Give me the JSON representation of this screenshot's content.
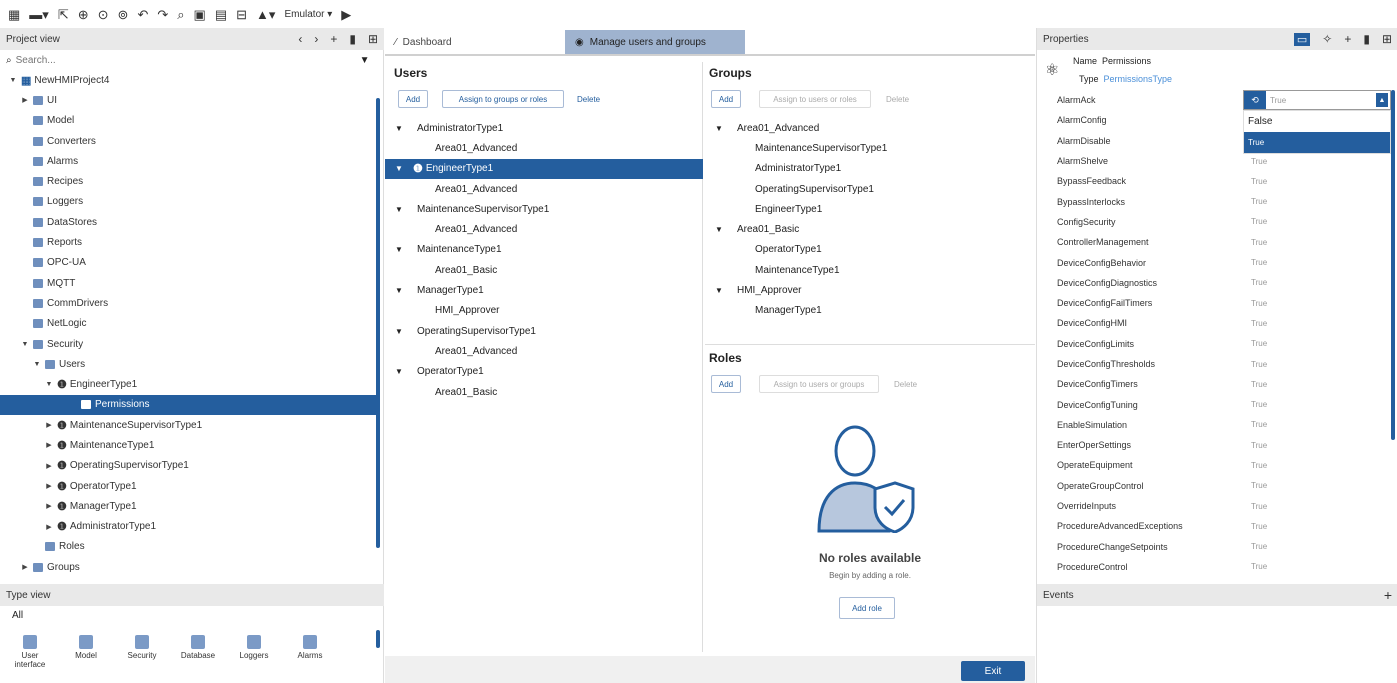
{
  "toolbar": {
    "grid": "▦",
    "save": "▬▾",
    "i1": "⇱",
    "i2": "⊕",
    "i3": "⊙",
    "i4": "⊚",
    "undo": "↶",
    "redo": "↷",
    "zoom": "⌕",
    "i5": "▣",
    "i6": "▤",
    "i7": "⊟",
    "i8": "▲▾",
    "emulator": "Emulator ▾",
    "play": "▶"
  },
  "project_view": {
    "title": "Project view",
    "search_placeholder": "Search...",
    "tree": [
      {
        "label": "NewHMIProject4",
        "depth": 0,
        "tw": "▼",
        "icon": "proj"
      },
      {
        "label": "UI",
        "depth": 1,
        "tw": "▶",
        "icon": "folder"
      },
      {
        "label": "Model",
        "depth": 1,
        "tw": "",
        "icon": "folder"
      },
      {
        "label": "Converters",
        "depth": 1,
        "tw": "",
        "icon": "folder"
      },
      {
        "label": "Alarms",
        "depth": 1,
        "tw": "",
        "icon": "folder"
      },
      {
        "label": "Recipes",
        "depth": 1,
        "tw": "",
        "icon": "folder"
      },
      {
        "label": "Loggers",
        "depth": 1,
        "tw": "",
        "icon": "folder"
      },
      {
        "label": "DataStores",
        "depth": 1,
        "tw": "",
        "icon": "folder"
      },
      {
        "label": "Reports",
        "depth": 1,
        "tw": "",
        "icon": "folder"
      },
      {
        "label": "OPC-UA",
        "depth": 1,
        "tw": "",
        "icon": "folder"
      },
      {
        "label": "MQTT",
        "depth": 1,
        "tw": "",
        "icon": "folder"
      },
      {
        "label": "CommDrivers",
        "depth": 1,
        "tw": "",
        "icon": "folder"
      },
      {
        "label": "NetLogic",
        "depth": 1,
        "tw": "",
        "icon": "folder"
      },
      {
        "label": "Security",
        "depth": 1,
        "tw": "▼",
        "icon": "folder"
      },
      {
        "label": "Users",
        "depth": 2,
        "tw": "▼",
        "icon": "folder"
      },
      {
        "label": "EngineerType1",
        "depth": 3,
        "tw": "▼",
        "icon": "user"
      },
      {
        "label": "Permissions",
        "depth": 5,
        "tw": "",
        "icon": "folder",
        "selected": true
      },
      {
        "label": "MaintenanceSupervisorType1",
        "depth": 3,
        "tw": "▶",
        "icon": "user"
      },
      {
        "label": "MaintenanceType1",
        "depth": 3,
        "tw": "▶",
        "icon": "user"
      },
      {
        "label": "OperatingSupervisorType1",
        "depth": 3,
        "tw": "▶",
        "icon": "user"
      },
      {
        "label": "OperatorType1",
        "depth": 3,
        "tw": "▶",
        "icon": "user"
      },
      {
        "label": "ManagerType1",
        "depth": 3,
        "tw": "▶",
        "icon": "user"
      },
      {
        "label": "AdministratorType1",
        "depth": 3,
        "tw": "▶",
        "icon": "user"
      },
      {
        "label": "Roles",
        "depth": 2,
        "tw": "",
        "icon": "folder"
      },
      {
        "label": "Groups",
        "depth": 1,
        "tw": "▶",
        "icon": "folder"
      }
    ]
  },
  "type_view": {
    "title": "Type view",
    "filter": "All",
    "items": [
      "User interface",
      "Model",
      "Security",
      "Database",
      "Loggers",
      "Alarms"
    ]
  },
  "tabs": [
    {
      "label": "Dashboard",
      "icon": "⁄"
    },
    {
      "label": "Manage users and groups",
      "icon": "◉"
    }
  ],
  "users": {
    "title": "Users",
    "add": "Add",
    "assign": "Assign to groups or roles",
    "delete": "Delete",
    "list": [
      {
        "label": "AdministratorType1",
        "type": "parent"
      },
      {
        "label": "Area01_Advanced",
        "type": "child"
      },
      {
        "label": "EngineerType1",
        "type": "parent",
        "selected": true
      },
      {
        "label": "Area01_Advanced",
        "type": "child"
      },
      {
        "label": "MaintenanceSupervisorType1",
        "type": "parent"
      },
      {
        "label": "Area01_Advanced",
        "type": "child"
      },
      {
        "label": "MaintenanceType1",
        "type": "parent"
      },
      {
        "label": "Area01_Basic",
        "type": "child"
      },
      {
        "label": "ManagerType1",
        "type": "parent"
      },
      {
        "label": "HMI_Approver",
        "type": "child"
      },
      {
        "label": "OperatingSupervisorType1",
        "type": "parent"
      },
      {
        "label": "Area01_Advanced",
        "type": "child"
      },
      {
        "label": "OperatorType1",
        "type": "parent"
      },
      {
        "label": "Area01_Basic",
        "type": "child"
      }
    ]
  },
  "groups": {
    "title": "Groups",
    "add": "Add",
    "assign": "Assign to users or roles",
    "delete": "Delete",
    "list": [
      {
        "label": "Area01_Advanced",
        "type": "parent"
      },
      {
        "label": "MaintenanceSupervisorType1",
        "type": "child"
      },
      {
        "label": "AdministratorType1",
        "type": "child"
      },
      {
        "label": "OperatingSupervisorType1",
        "type": "child"
      },
      {
        "label": "EngineerType1",
        "type": "child"
      },
      {
        "label": "Area01_Basic",
        "type": "parent"
      },
      {
        "label": "OperatorType1",
        "type": "child"
      },
      {
        "label": "MaintenanceType1",
        "type": "child"
      },
      {
        "label": "HMI_Approver",
        "type": "parent"
      },
      {
        "label": "ManagerType1",
        "type": "child"
      }
    ]
  },
  "roles": {
    "title": "Roles",
    "add": "Add",
    "assign": "Assign to users or groups",
    "delete": "Delete",
    "empty_title": "No roles available",
    "empty_sub": "Begin by adding a role.",
    "add_role": "Add role"
  },
  "exit": "Exit",
  "properties": {
    "title": "Properties",
    "name_label": "Name",
    "name_value": "Permissions",
    "type_label": "Type",
    "type_value": "PermissionsType",
    "accent": "#245e9e",
    "dropdown": {
      "value": "True",
      "options": [
        "False",
        "True"
      ],
      "selected": "True"
    },
    "items": [
      {
        "name": "AlarmAck",
        "value": ""
      },
      {
        "name": "AlarmConfig",
        "value": ""
      },
      {
        "name": "AlarmDisable",
        "value": ""
      },
      {
        "name": "AlarmShelve",
        "value": "True"
      },
      {
        "name": "BypassFeedback",
        "value": "True"
      },
      {
        "name": "BypassInterlocks",
        "value": "True"
      },
      {
        "name": "ConfigSecurity",
        "value": "True"
      },
      {
        "name": "ControllerManagement",
        "value": "True"
      },
      {
        "name": "DeviceConfigBehavior",
        "value": "True"
      },
      {
        "name": "DeviceConfigDiagnostics",
        "value": "True"
      },
      {
        "name": "DeviceConfigFailTimers",
        "value": "True"
      },
      {
        "name": "DeviceConfigHMI",
        "value": "True"
      },
      {
        "name": "DeviceConfigLimits",
        "value": "True"
      },
      {
        "name": "DeviceConfigThresholds",
        "value": "True"
      },
      {
        "name": "DeviceConfigTimers",
        "value": "True"
      },
      {
        "name": "DeviceConfigTuning",
        "value": "True"
      },
      {
        "name": "EnableSimulation",
        "value": "True"
      },
      {
        "name": "EnterOperSettings",
        "value": "True"
      },
      {
        "name": "OperateEquipment",
        "value": "True"
      },
      {
        "name": "OperateGroupControl",
        "value": "True"
      },
      {
        "name": "OverrideInputs",
        "value": "True"
      },
      {
        "name": "ProcedureAdvancedExceptions",
        "value": "True"
      },
      {
        "name": "ProcedureChangeSetpoints",
        "value": "True"
      },
      {
        "name": "ProcedureControl",
        "value": "True"
      }
    ]
  },
  "events": {
    "title": "Events",
    "plus": "+"
  }
}
